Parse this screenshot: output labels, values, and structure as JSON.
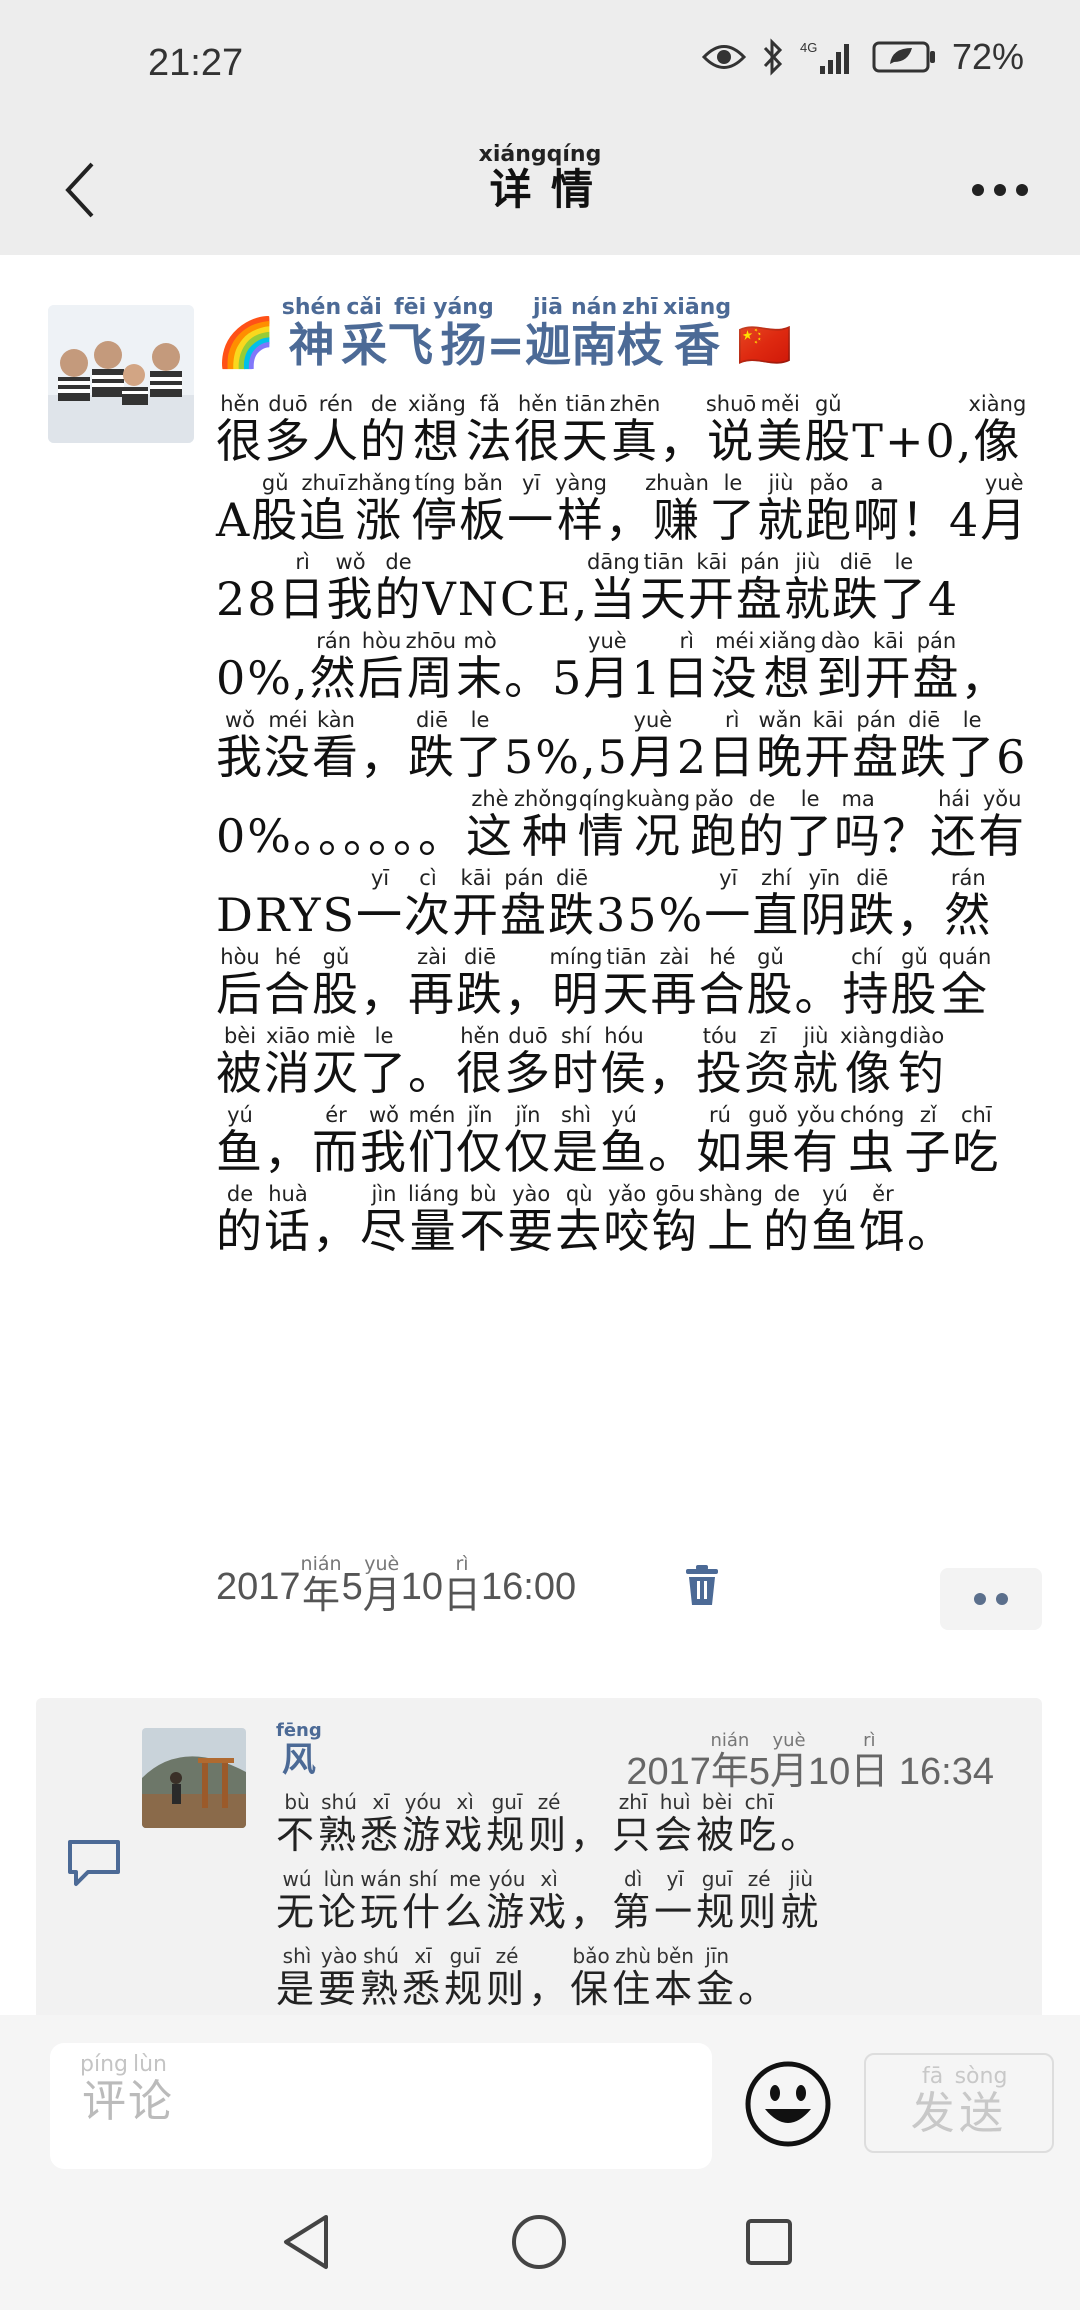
{
  "status_bar": {
    "time": "21:27",
    "battery": "72%"
  },
  "nav": {
    "title_chars": [
      [
        "详",
        "xiáng"
      ],
      [
        "情",
        "qíng"
      ]
    ]
  },
  "post": {
    "author_chars": [
      [
        "神",
        "shén"
      ],
      [
        "采",
        "cǎi"
      ],
      [
        "飞",
        "fēi"
      ],
      [
        "扬",
        "yáng"
      ],
      [
        "=",
        ""
      ],
      [
        "迦",
        "jiā"
      ],
      [
        "南",
        "nán"
      ],
      [
        "枝",
        "zhī"
      ],
      [
        "香",
        "xiāng"
      ]
    ],
    "author_prefix_emoji": "🌈",
    "author_suffix_emoji": "🇨🇳",
    "body": [
      [
        "很",
        "hěn"
      ],
      [
        "多",
        "duō"
      ],
      [
        "人",
        "rén"
      ],
      [
        "的",
        "de"
      ],
      [
        "想",
        "xiǎng"
      ],
      [
        "法",
        "fǎ"
      ],
      [
        "很",
        "hěn"
      ],
      [
        "天",
        "tiān"
      ],
      [
        "真",
        "zhēn"
      ],
      [
        "，",
        ""
      ],
      [
        "说",
        "shuō"
      ],
      [
        "美",
        "měi"
      ],
      [
        "股",
        "gǔ"
      ],
      [
        "T+0,",
        ""
      ],
      [
        "像",
        "xiàng"
      ],
      [
        "A",
        ""
      ],
      [
        "股",
        "gǔ"
      ],
      [
        "追",
        "zhuī"
      ],
      [
        "涨",
        "zhǎng"
      ],
      [
        "停",
        "tíng"
      ],
      [
        "板",
        "bǎn"
      ],
      [
        "一",
        "yī"
      ],
      [
        "样",
        "yàng"
      ],
      [
        "，",
        ""
      ],
      [
        "赚",
        "zhuàn"
      ],
      [
        "了",
        "le"
      ],
      [
        "就",
        "jiù"
      ],
      [
        "跑",
        "pǎo"
      ],
      [
        "啊",
        "a"
      ],
      [
        "！",
        ""
      ],
      [
        "4",
        ""
      ],
      [
        "月",
        "yuè"
      ],
      [
        "28",
        ""
      ],
      [
        "日",
        "rì"
      ],
      [
        "我",
        "wǒ"
      ],
      [
        "的",
        "de"
      ],
      [
        "VNCE,",
        ""
      ],
      [
        "当",
        "dāng"
      ],
      [
        "天",
        "tiān"
      ],
      [
        "开",
        "kāi"
      ],
      [
        "盘",
        "pán"
      ],
      [
        "就",
        "jiù"
      ],
      [
        "跌",
        "diē"
      ],
      [
        "了",
        "le"
      ],
      [
        "40%,",
        ""
      ],
      [
        "然",
        "rán"
      ],
      [
        "后",
        "hòu"
      ],
      [
        "周",
        "zhōu"
      ],
      [
        "末",
        "mò"
      ],
      [
        "。",
        ""
      ],
      [
        "5",
        ""
      ],
      [
        "月",
        "yuè"
      ],
      [
        "1",
        ""
      ],
      [
        "日",
        "rì"
      ],
      [
        "没",
        "méi"
      ],
      [
        "想",
        "xiǎng"
      ],
      [
        "到",
        "dào"
      ],
      [
        "开",
        "kāi"
      ],
      [
        "盘",
        "pán"
      ],
      [
        "，",
        ""
      ],
      [
        "我",
        "wǒ"
      ],
      [
        "没",
        "méi"
      ],
      [
        "看",
        "kàn"
      ],
      [
        "，",
        ""
      ],
      [
        "跌",
        "diē"
      ],
      [
        "了",
        "le"
      ],
      [
        "5%,",
        ""
      ],
      [
        "5",
        ""
      ],
      [
        "月",
        "yuè"
      ],
      [
        "2",
        ""
      ],
      [
        "日",
        "rì"
      ],
      [
        "晚",
        "wǎn"
      ],
      [
        "开",
        "kāi"
      ],
      [
        "盘",
        "pán"
      ],
      [
        "跌",
        "diē"
      ],
      [
        "了",
        "le"
      ],
      [
        "60%。。。。。。",
        ""
      ],
      [
        "这",
        "zhè"
      ],
      [
        "种",
        "zhǒng"
      ],
      [
        "情",
        "qíng"
      ],
      [
        "况",
        "kuàng"
      ],
      [
        "跑",
        "pǎo"
      ],
      [
        "的",
        "de"
      ],
      [
        "了",
        "le"
      ],
      [
        "吗",
        "ma"
      ],
      [
        "？",
        ""
      ],
      [
        "还",
        "hái"
      ],
      [
        "有",
        "yǒu"
      ],
      [
        "DRYS",
        ""
      ],
      [
        "一",
        "yī"
      ],
      [
        "次",
        "cì"
      ],
      [
        "开",
        "kāi"
      ],
      [
        "盘",
        "pán"
      ],
      [
        "跌",
        "diē"
      ],
      [
        "35%",
        ""
      ],
      [
        "一",
        "yī"
      ],
      [
        "直",
        "zhí"
      ],
      [
        "阴",
        "yīn"
      ],
      [
        "跌",
        "diē"
      ],
      [
        "，",
        ""
      ],
      [
        "然",
        "rán"
      ],
      [
        "后",
        "hòu"
      ],
      [
        "合",
        "hé"
      ],
      [
        "股",
        "gǔ"
      ],
      [
        "，",
        ""
      ],
      [
        "再",
        "zài"
      ],
      [
        "跌",
        "diē"
      ],
      [
        "，",
        ""
      ],
      [
        "明",
        "míng"
      ],
      [
        "天",
        "tiān"
      ],
      [
        "再",
        "zài"
      ],
      [
        "合",
        "hé"
      ],
      [
        "股",
        "gǔ"
      ],
      [
        "。",
        ""
      ],
      [
        "持",
        "chí"
      ],
      [
        "股",
        "gǔ"
      ],
      [
        "全",
        "quán"
      ],
      [
        "被",
        "bèi"
      ],
      [
        "消",
        "xiāo"
      ],
      [
        "灭",
        "miè"
      ],
      [
        "了",
        "le"
      ],
      [
        "。",
        ""
      ],
      [
        "很",
        "hěn"
      ],
      [
        "多",
        "duō"
      ],
      [
        "时",
        "shí"
      ],
      [
        "侯",
        "hóu"
      ],
      [
        "，",
        ""
      ],
      [
        "投",
        "tóu"
      ],
      [
        "资",
        "zī"
      ],
      [
        "就",
        "jiù"
      ],
      [
        "像",
        "xiàng"
      ],
      [
        "钓",
        "diào"
      ],
      [
        "鱼",
        "yú"
      ],
      [
        "，",
        ""
      ],
      [
        "而",
        "ér"
      ],
      [
        "我",
        "wǒ"
      ],
      [
        "们",
        "mén"
      ],
      [
        "仅",
        "jǐn"
      ],
      [
        "仅",
        "jǐn"
      ],
      [
        "是",
        "shì"
      ],
      [
        "鱼",
        "yú"
      ],
      [
        "。",
        ""
      ],
      [
        "如",
        "rú"
      ],
      [
        "果",
        "guǒ"
      ],
      [
        "有",
        "yǒu"
      ],
      [
        "虫",
        "chóng"
      ],
      [
        "子",
        "zǐ"
      ],
      [
        "吃",
        "chī"
      ],
      [
        "的",
        "de"
      ],
      [
        "话",
        "huà"
      ],
      [
        "，",
        ""
      ],
      [
        "尽",
        "jìn"
      ],
      [
        "量",
        "liáng"
      ],
      [
        "不",
        "bù"
      ],
      [
        "要",
        "yào"
      ],
      [
        "去",
        "qù"
      ],
      [
        "咬",
        "yǎo"
      ],
      [
        "钩",
        "gōu"
      ],
      [
        "上",
        "shàng"
      ],
      [
        "的",
        "de"
      ],
      [
        "鱼",
        "yú"
      ],
      [
        "饵",
        "ěr"
      ],
      [
        "。",
        ""
      ]
    ],
    "timestamp_chars": [
      [
        "2017",
        ""
      ],
      [
        "年",
        "nián"
      ],
      [
        "5",
        ""
      ],
      [
        "月",
        "yuè"
      ],
      [
        "10",
        ""
      ],
      [
        "日",
        "rì"
      ],
      [
        " 16:00",
        ""
      ]
    ]
  },
  "comment": {
    "author_chars": [
      [
        "风",
        "fēng"
      ]
    ],
    "timestamp_chars": [
      [
        "2017",
        ""
      ],
      [
        "年",
        "nián"
      ],
      [
        "5",
        ""
      ],
      [
        "月",
        "yuè"
      ],
      [
        "10",
        ""
      ],
      [
        "日",
        "rì"
      ],
      [
        " 16:34",
        ""
      ]
    ],
    "lines": [
      [
        [
          "不",
          "bù"
        ],
        [
          "熟",
          "shú"
        ],
        [
          "悉",
          "xī"
        ],
        [
          "游",
          "yóu"
        ],
        [
          "戏",
          "xì"
        ],
        [
          "规",
          "guī"
        ],
        [
          "则",
          "zé"
        ],
        [
          "，",
          ""
        ],
        [
          "只",
          "zhī"
        ],
        [
          "会",
          "huì"
        ],
        [
          "被",
          "bèi"
        ],
        [
          "吃",
          "chī"
        ],
        [
          "。",
          ""
        ]
      ],
      [
        [
          "无",
          "wú"
        ],
        [
          "论",
          "lùn"
        ],
        [
          "玩",
          "wán"
        ],
        [
          "什",
          "shí"
        ],
        [
          "么",
          "me"
        ],
        [
          "游",
          "yóu"
        ],
        [
          "戏",
          "xì"
        ],
        [
          "，",
          ""
        ],
        [
          "第",
          "dì"
        ],
        [
          "一",
          "yī"
        ],
        [
          "规",
          "guī"
        ],
        [
          "则",
          "zé"
        ],
        [
          "就",
          "jiù"
        ]
      ],
      [
        [
          "是",
          "shì"
        ],
        [
          "要",
          "yào"
        ],
        [
          "熟",
          "shú"
        ],
        [
          "悉",
          "xī"
        ],
        [
          "规",
          "guī"
        ],
        [
          "则",
          "zé"
        ],
        [
          "，",
          ""
        ],
        [
          "保",
          "bǎo"
        ],
        [
          "住",
          "zhù"
        ],
        [
          "本",
          "běn"
        ],
        [
          "金",
          "jīn"
        ],
        [
          "。",
          ""
        ]
      ]
    ]
  },
  "composer": {
    "placeholder_chars": [
      [
        "评",
        "píng"
      ],
      [
        "论",
        "lùn"
      ]
    ],
    "send_chars": [
      [
        "发",
        "fā"
      ],
      [
        "送",
        "sòng"
      ]
    ]
  }
}
